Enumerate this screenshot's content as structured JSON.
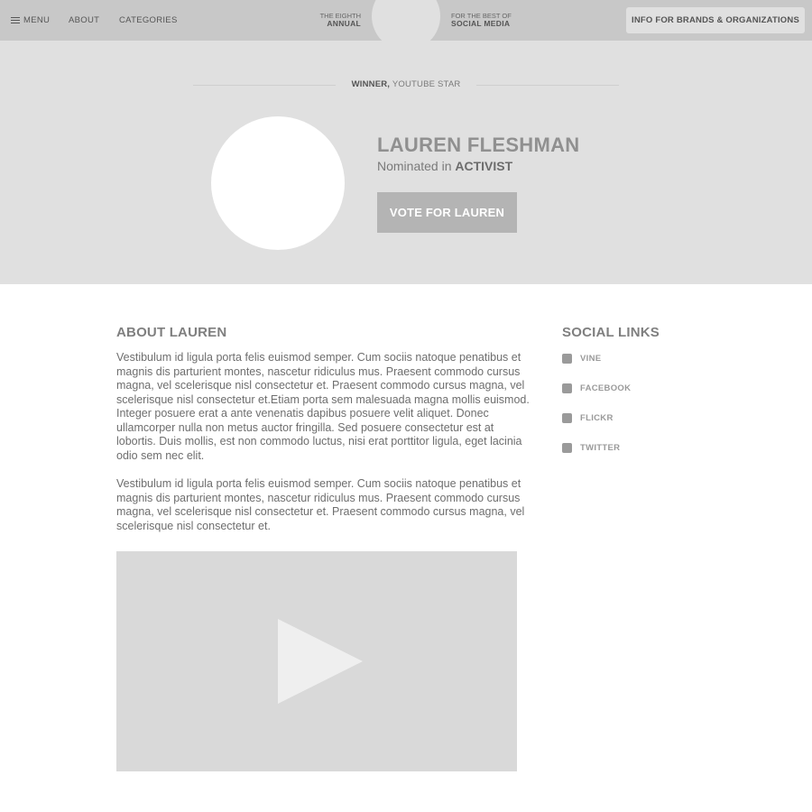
{
  "nav": {
    "menu_label": "MENU",
    "about_label": "ABOUT",
    "categories_label": "CATEGORIES",
    "brand_left_top": "THE EIGHTH",
    "brand_left_bottom": "ANNUAL",
    "brand_right_top": "FOR THE BEST OF",
    "brand_right_bottom": "SOCIAL MEDIA",
    "info_button": "INFO FOR BRANDS & ORGANIZATIONS"
  },
  "hero": {
    "winner_strong": "WINNER,",
    "winner_rest": " YOUTUBE STAR",
    "name": "LAUREN FLESHMAN",
    "nominated_prefix": "Nominated in ",
    "nominated_category": "ACTIVIST",
    "vote_button": "VOTE FOR LAUREN"
  },
  "about": {
    "title": "ABOUT LAUREN",
    "paragraph1": "Vestibulum id ligula porta felis euismod semper. Cum sociis natoque penatibus et magnis dis parturient montes, nascetur ridiculus mus. Praesent commodo cursus magna, vel scelerisque nisl consectetur et. Praesent commodo cursus magna, vel scelerisque nisl consectetur et.Etiam porta sem malesuada magna mollis euismod. Integer posuere erat a ante venenatis dapibus posuere velit aliquet. Donec ullamcorper nulla non metus auctor fringilla. Sed posuere consectetur est at lobortis. Duis mollis, est non commodo luctus, nisi erat porttitor ligula, eget lacinia odio sem nec elit.",
    "paragraph2": "Vestibulum id ligula porta felis euismod semper. Cum sociis natoque penatibus et magnis dis parturient montes, nascetur ridiculus mus. Praesent commodo cursus magna, vel scelerisque nisl consectetur et. Praesent commodo cursus magna, vel scelerisque nisl consectetur et."
  },
  "social": {
    "title": "SOCIAL LINKS",
    "items": [
      {
        "label": "VINE"
      },
      {
        "label": "FACEBOOK"
      },
      {
        "label": "FLICKR"
      },
      {
        "label": "TWITTER"
      }
    ]
  },
  "colors": {
    "nav_bg": "#c8c8c8",
    "hero_bg": "#e0e0e0",
    "vote_button_bg": "#b4b4b4",
    "video_bg": "#d9d9d9"
  }
}
